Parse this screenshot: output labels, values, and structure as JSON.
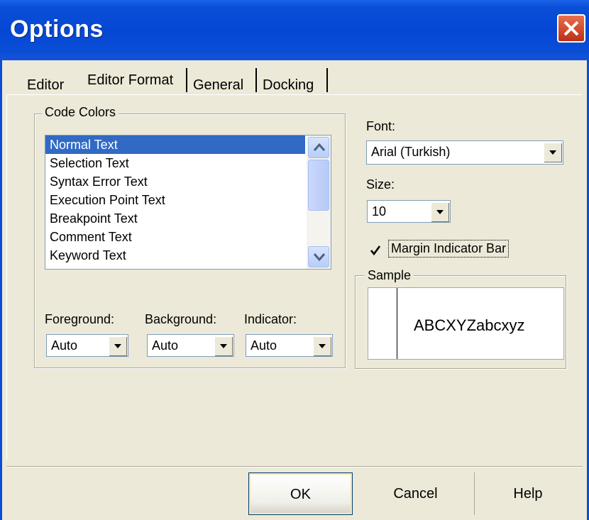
{
  "window": {
    "title": "Options"
  },
  "tabs": [
    "Editor",
    "Editor Format",
    "General",
    "Docking"
  ],
  "code_colors": {
    "legend": "Code Colors",
    "items": [
      "Normal Text",
      "Selection Text",
      "Syntax Error Text",
      "Execution Point Text",
      "Breakpoint Text",
      "Comment Text",
      "Keyword Text"
    ],
    "selected": "Normal Text"
  },
  "foreground": {
    "label": "Foreground:",
    "value": "Auto"
  },
  "background": {
    "label": "Background:",
    "value": "Auto"
  },
  "indicator": {
    "label": "Indicator:",
    "value": "Auto"
  },
  "font": {
    "label": "Font:",
    "value": "Arial (Turkish)"
  },
  "size": {
    "label": "Size:",
    "value": "10"
  },
  "margin_indicator": {
    "label": "Margin Indicator Bar",
    "checked": true
  },
  "sample": {
    "legend": "Sample",
    "text": "ABCXYZabcxyz"
  },
  "buttons": {
    "ok": "OK",
    "cancel": "Cancel",
    "help": "Help"
  },
  "colors": {
    "titlebar": "#0547d4",
    "selection": "#316ac5",
    "close": "#d1482a"
  }
}
